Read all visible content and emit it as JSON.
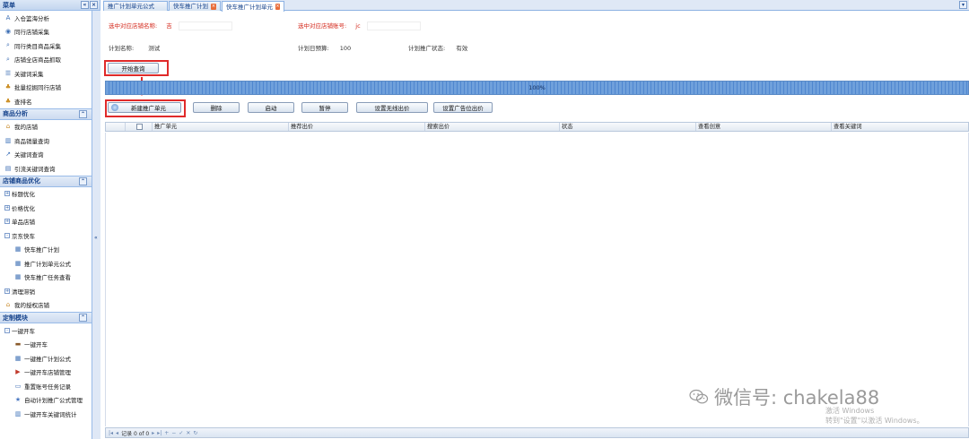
{
  "sidebar": {
    "title": "菜单",
    "header_buttons": [
      "«",
      "×"
    ],
    "top_items": [
      {
        "icon": "text-a-icon",
        "label": "入仓篮海分析"
      },
      {
        "icon": "eye-icon",
        "label": "同行店铺采集"
      },
      {
        "icon": "magnifier-icon",
        "label": "同行类目商品采集"
      },
      {
        "icon": "magnifier-icon",
        "label": "店铺全店商品抓取"
      },
      {
        "icon": "list-icon",
        "label": "关键词采集"
      },
      {
        "icon": "users-icon",
        "label": "批量挖掘同行店铺"
      },
      {
        "icon": "users-icon",
        "label": "查排名"
      }
    ],
    "sections": [
      {
        "title": "商品分析",
        "items": [
          {
            "icon": "home-icon",
            "label": "我的店铺"
          },
          {
            "icon": "chart-icon",
            "label": "商品销量查询"
          },
          {
            "icon": "trend-icon",
            "label": "关键词查询"
          },
          {
            "icon": "doc-icon",
            "label": "引流关键词查询"
          }
        ]
      },
      {
        "title": "店铺商品优化",
        "items": [
          {
            "toggle": "+",
            "label": "标题优化"
          },
          {
            "toggle": "+",
            "label": "价格优化"
          },
          {
            "toggle": "+",
            "label": "单品店铺"
          },
          {
            "toggle": "-",
            "label": "京东快车"
          },
          {
            "sub": true,
            "icon": "grid-icon",
            "label": "快车推广计划"
          },
          {
            "sub": true,
            "icon": "grid-icon",
            "label": "推广计划单元公式"
          },
          {
            "sub": true,
            "icon": "grid-icon",
            "label": "快车推广任务查看"
          },
          {
            "toggle": "+",
            "label": "清理滞销"
          },
          {
            "icon": "home-icon",
            "label": "我的授权店铺"
          }
        ]
      },
      {
        "title": "定制模块",
        "items": [
          {
            "toggle": "-",
            "label": "一键开车"
          },
          {
            "sub": true,
            "icon": "car-icon",
            "label": "一键开车"
          },
          {
            "sub": true,
            "icon": "table-icon",
            "label": "一键推广计划公式"
          },
          {
            "sub": true,
            "icon": "flag-icon",
            "label": "一键开车店铺管理"
          },
          {
            "sub": true,
            "icon": "minus-box-icon",
            "label": "重置账号任务记录"
          },
          {
            "sub": true,
            "icon": "star-icon",
            "label": "自动计划推广公式管理"
          },
          {
            "sub": true,
            "icon": "chart-icon",
            "label": "一键开车关键词统计"
          }
        ]
      }
    ]
  },
  "tabs": [
    {
      "label": "推广计划单元公式",
      "closable": false,
      "active": false
    },
    {
      "label": "快车推广计划",
      "closable": true,
      "active": false
    },
    {
      "label": "快车推广计划单元",
      "closable": true,
      "active": true
    }
  ],
  "info": {
    "shop_name_label": "选中对应店铺名称:",
    "shop_name_value": "吉",
    "shop_account_label": "选中对应店铺账号:",
    "shop_account_value": "jc",
    "plan_name_label": "计划名称:",
    "plan_name_value": "测试",
    "daily_budget_label": "计划日预算:",
    "daily_budget_value": "100",
    "plan_status_label": "计划推广状态:",
    "plan_status_value": "有效"
  },
  "start_query_label": "开始查询",
  "progress": {
    "percent": 100,
    "text": "100%"
  },
  "toolbar": {
    "new_unit": "新建推广单元",
    "delete": "删除",
    "start": "启动",
    "pause": "暂停",
    "set_wireless_bid": "设置无线出价",
    "set_ad_bid": "设置广告位出价"
  },
  "grid": {
    "columns": [
      "推广单元",
      "推荐出价",
      "搜索出价",
      "状态",
      "查看创意",
      "查看关键词"
    ]
  },
  "pager": {
    "record_text": "记录 0 of 0"
  },
  "watermark": {
    "text": "微信号: chakela88"
  },
  "activation": {
    "line1": "激活 Windows",
    "line2": "转到\"设置\"以激活 Windows。"
  },
  "colors": {
    "accent_blue": "#15428b",
    "highlight_red": "#e02a2a",
    "label_red": "#d4291c",
    "progress_blue": "#4f86cf"
  }
}
